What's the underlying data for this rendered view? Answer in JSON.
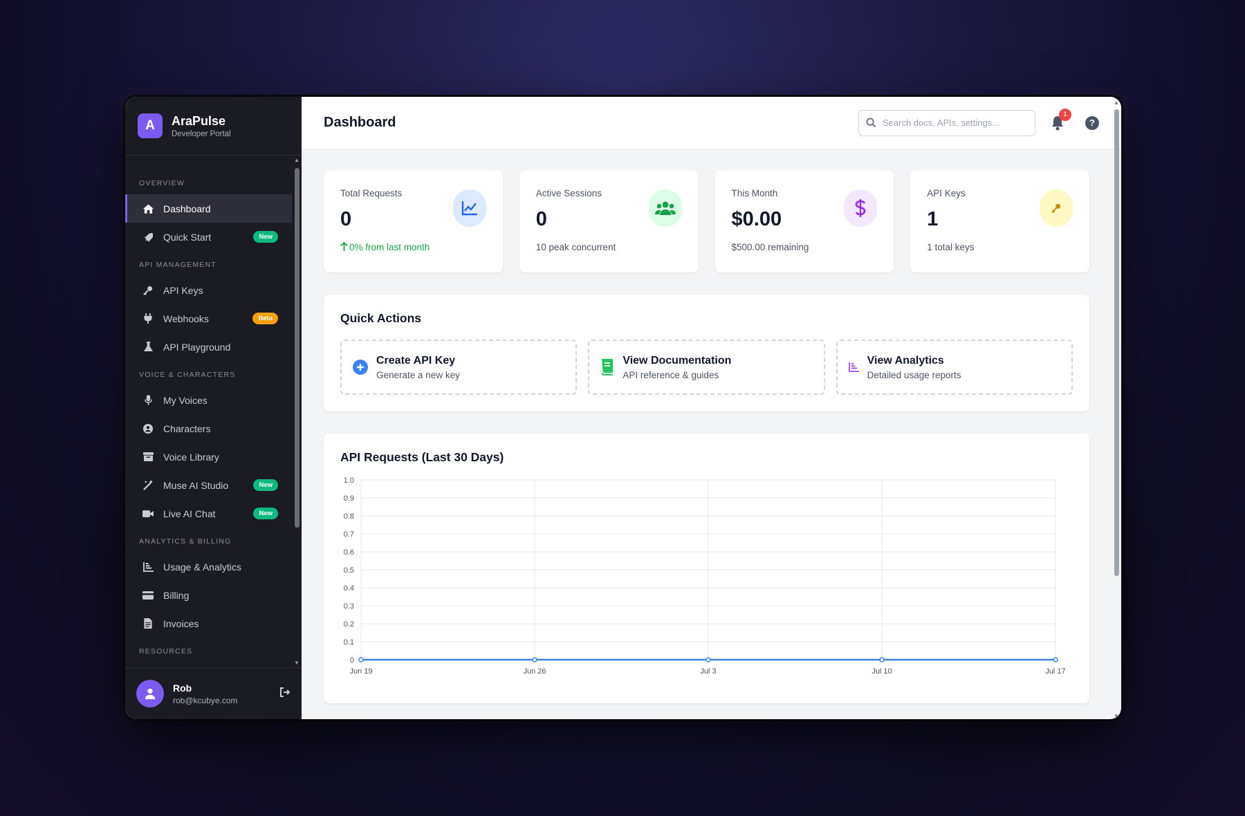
{
  "brand": {
    "logo_letter": "A",
    "name": "AraPulse",
    "subtitle": "Developer Portal"
  },
  "sidebar": {
    "sections": [
      {
        "label": "OVERVIEW",
        "items": [
          {
            "label": "Dashboard",
            "icon": "home-icon",
            "active": true
          },
          {
            "label": "Quick Start",
            "icon": "rocket-icon",
            "badge": "New",
            "badge_type": "new"
          }
        ]
      },
      {
        "label": "API MANAGEMENT",
        "items": [
          {
            "label": "API Keys",
            "icon": "key-icon"
          },
          {
            "label": "Webhooks",
            "icon": "plug-icon",
            "badge": "Beta",
            "badge_type": "beta"
          },
          {
            "label": "API Playground",
            "icon": "flask-icon"
          }
        ]
      },
      {
        "label": "VOICE & CHARACTERS",
        "items": [
          {
            "label": "My Voices",
            "icon": "microphone-icon"
          },
          {
            "label": "Characters",
            "icon": "user-circle-icon"
          },
          {
            "label": "Voice Library",
            "icon": "archive-icon"
          },
          {
            "label": "Muse AI Studio",
            "icon": "magic-wand-icon",
            "badge": "New",
            "badge_type": "new"
          },
          {
            "label": "Live AI Chat",
            "icon": "video-icon",
            "badge": "New",
            "badge_type": "new"
          }
        ]
      },
      {
        "label": "ANALYTICS & BILLING",
        "items": [
          {
            "label": "Usage & Analytics",
            "icon": "bar-chart-icon"
          },
          {
            "label": "Billing",
            "icon": "credit-card-icon"
          },
          {
            "label": "Invoices",
            "icon": "invoice-icon"
          }
        ]
      },
      {
        "label": "RESOURCES",
        "items": []
      }
    ]
  },
  "user": {
    "name": "Rob",
    "email": "rob@kcubye.com"
  },
  "header": {
    "title": "Dashboard",
    "search_placeholder": "Search docs, APIs, settings...",
    "notification_count": "1",
    "help_label": "?"
  },
  "stats": [
    {
      "label": "Total Requests",
      "value": "0",
      "sub": "0% from last month",
      "sub_style": "up",
      "icon": "line-chart-icon",
      "icon_color": "#2563eb",
      "icon_bg": "#dbeafe"
    },
    {
      "label": "Active Sessions",
      "value": "0",
      "sub": "10 peak concurrent",
      "icon": "users-icon",
      "icon_color": "#16a34a",
      "icon_bg": "#dcfce7"
    },
    {
      "label": "This Month",
      "value": "$0.00",
      "sub": "$500.00 remaining",
      "icon": "dollar-icon",
      "icon_color": "#9333ea",
      "icon_bg": "#f3e8ff"
    },
    {
      "label": "API Keys",
      "value": "1",
      "sub": "1 total keys",
      "icon": "key-icon",
      "icon_color": "#ca8a04",
      "icon_bg": "#fef9c3"
    }
  ],
  "quick_actions": {
    "title": "Quick Actions",
    "items": [
      {
        "title": "Create API Key",
        "desc": "Generate a new key",
        "icon": "plus-circle-icon",
        "color": "#3b82f6"
      },
      {
        "title": "View Documentation",
        "desc": "API reference & guides",
        "icon": "book-icon",
        "color": "#22c55e"
      },
      {
        "title": "View Analytics",
        "desc": "Detailed usage reports",
        "icon": "bar-chart-icon",
        "color": "#a855f7"
      }
    ]
  },
  "chart_panel": {
    "title": "API Requests (Last 30 Days)"
  },
  "chart_data": {
    "type": "line",
    "title": "API Requests (Last 30 Days)",
    "x": [
      "Jun 19",
      "Jun 26",
      "Jul 3",
      "Jul 10",
      "Jul 17"
    ],
    "series": [
      {
        "values": [
          0,
          0,
          0,
          0,
          0
        ],
        "color": "#3b82f6"
      }
    ],
    "yticks": [
      "0",
      "0.1",
      "0.2",
      "0.3",
      "0.4",
      "0.5",
      "0.6",
      "0.7",
      "0.8",
      "0.9",
      "1.0"
    ],
    "ylim": [
      0,
      1
    ],
    "grid": true
  }
}
